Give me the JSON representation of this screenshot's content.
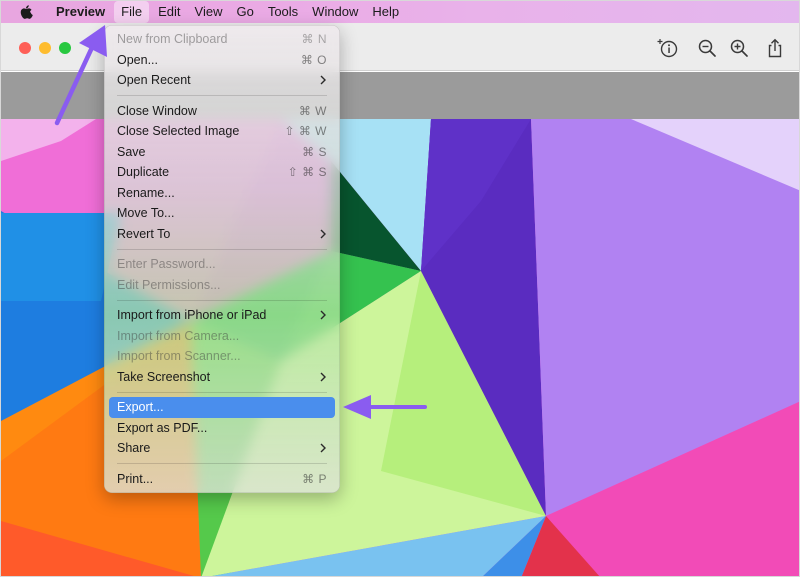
{
  "menubar": {
    "app_name": "Preview",
    "menus": [
      "File",
      "Edit",
      "View",
      "Go",
      "Tools",
      "Window",
      "Help"
    ]
  },
  "file_menu": {
    "groups": [
      [
        {
          "label": "New from Clipboard",
          "shortcut": "⌘ N",
          "enabled": false
        },
        {
          "label": "Open...",
          "shortcut": "⌘ O",
          "enabled": true
        },
        {
          "label": "Open Recent",
          "shortcut": "",
          "enabled": true,
          "submenu": true
        }
      ],
      [
        {
          "label": "Close Window",
          "shortcut": "⌘ W",
          "enabled": true
        },
        {
          "label": "Close Selected Image",
          "shortcut": "⇧ ⌘ W",
          "enabled": true
        },
        {
          "label": "Save",
          "shortcut": "⌘ S",
          "enabled": true
        },
        {
          "label": "Duplicate",
          "shortcut": "⇧ ⌘ S",
          "enabled": true
        },
        {
          "label": "Rename...",
          "shortcut": "",
          "enabled": true
        },
        {
          "label": "Move To...",
          "shortcut": "",
          "enabled": true
        },
        {
          "label": "Revert To",
          "shortcut": "",
          "enabled": true,
          "submenu": true
        }
      ],
      [
        {
          "label": "Enter Password...",
          "shortcut": "",
          "enabled": false
        },
        {
          "label": "Edit Permissions...",
          "shortcut": "",
          "enabled": false
        }
      ],
      [
        {
          "label": "Import from iPhone or iPad",
          "shortcut": "",
          "enabled": true,
          "submenu": true
        },
        {
          "label": "Import from Camera...",
          "shortcut": "",
          "enabled": false
        },
        {
          "label": "Import from Scanner...",
          "shortcut": "",
          "enabled": false
        },
        {
          "label": "Take Screenshot",
          "shortcut": "",
          "enabled": true,
          "submenu": true
        }
      ],
      [
        {
          "label": "Export...",
          "shortcut": "",
          "enabled": true,
          "highlighted": true
        },
        {
          "label": "Export as PDF...",
          "shortcut": "",
          "enabled": true
        },
        {
          "label": "Share",
          "shortcut": "",
          "enabled": true,
          "submenu": true
        }
      ],
      [
        {
          "label": "Print...",
          "shortcut": "⌘ P",
          "enabled": true
        }
      ]
    ]
  },
  "toolbar": {
    "icons": [
      "info-icon",
      "zoom-out-icon",
      "zoom-in-icon",
      "share-icon"
    ]
  },
  "colors": {
    "highlight": "#4a8eed",
    "annotation_arrow": "#8a5cf0",
    "traffic_red": "#fe5f57",
    "traffic_yellow": "#febc2e",
    "traffic_green": "#28c840"
  }
}
